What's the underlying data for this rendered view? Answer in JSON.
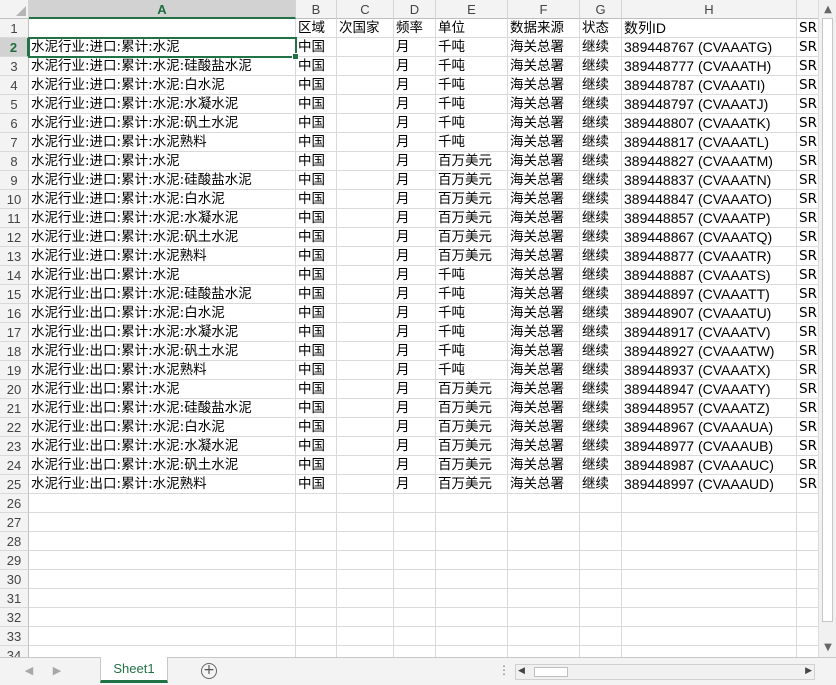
{
  "columns": [
    "A",
    "B",
    "C",
    "D",
    "E",
    "F",
    "G",
    "H",
    ""
  ],
  "selected_column": "A",
  "selected_row": 2,
  "header_row": {
    "row_number": "1",
    "cells": [
      "",
      "区域",
      "次国家",
      "频率",
      "单位",
      "数据来源",
      "状态",
      "数列ID",
      "SR"
    ]
  },
  "data_rows": [
    {
      "row": "2",
      "cells": [
        "水泥行业:进口:累计:水泥",
        "中国",
        "",
        "月",
        "千吨",
        "海关总署",
        "继续",
        "389448767 (CVAAATG)",
        "SR"
      ]
    },
    {
      "row": "3",
      "cells": [
        "水泥行业:进口:累计:水泥:硅酸盐水泥",
        "中国",
        "",
        "月",
        "千吨",
        "海关总署",
        "继续",
        "389448777 (CVAAATH)",
        "SR"
      ]
    },
    {
      "row": "4",
      "cells": [
        "水泥行业:进口:累计:水泥:白水泥",
        "中国",
        "",
        "月",
        "千吨",
        "海关总署",
        "继续",
        "389448787 (CVAAATI)",
        "SR"
      ]
    },
    {
      "row": "5",
      "cells": [
        "水泥行业:进口:累计:水泥:水凝水泥",
        "中国",
        "",
        "月",
        "千吨",
        "海关总署",
        "继续",
        "389448797 (CVAAATJ)",
        "SR"
      ]
    },
    {
      "row": "6",
      "cells": [
        "水泥行业:进口:累计:水泥:矾土水泥",
        "中国",
        "",
        "月",
        "千吨",
        "海关总署",
        "继续",
        "389448807 (CVAAATK)",
        "SR"
      ]
    },
    {
      "row": "7",
      "cells": [
        "水泥行业:进口:累计:水泥熟料",
        "中国",
        "",
        "月",
        "千吨",
        "海关总署",
        "继续",
        "389448817 (CVAAATL)",
        "SR"
      ]
    },
    {
      "row": "8",
      "cells": [
        "水泥行业:进口:累计:水泥",
        "中国",
        "",
        "月",
        "百万美元",
        "海关总署",
        "继续",
        "389448827 (CVAAATM)",
        "SR"
      ]
    },
    {
      "row": "9",
      "cells": [
        "水泥行业:进口:累计:水泥:硅酸盐水泥",
        "中国",
        "",
        "月",
        "百万美元",
        "海关总署",
        "继续",
        "389448837 (CVAAATN)",
        "SR"
      ]
    },
    {
      "row": "10",
      "cells": [
        "水泥行业:进口:累计:水泥:白水泥",
        "中国",
        "",
        "月",
        "百万美元",
        "海关总署",
        "继续",
        "389448847 (CVAAATO)",
        "SR"
      ]
    },
    {
      "row": "11",
      "cells": [
        "水泥行业:进口:累计:水泥:水凝水泥",
        "中国",
        "",
        "月",
        "百万美元",
        "海关总署",
        "继续",
        "389448857 (CVAAATP)",
        "SR"
      ]
    },
    {
      "row": "12",
      "cells": [
        "水泥行业:进口:累计:水泥:矾土水泥",
        "中国",
        "",
        "月",
        "百万美元",
        "海关总署",
        "继续",
        "389448867 (CVAAATQ)",
        "SR"
      ]
    },
    {
      "row": "13",
      "cells": [
        "水泥行业:进口:累计:水泥熟料",
        "中国",
        "",
        "月",
        "百万美元",
        "海关总署",
        "继续",
        "389448877 (CVAAATR)",
        "SR"
      ]
    },
    {
      "row": "14",
      "cells": [
        "水泥行业:出口:累计:水泥",
        "中国",
        "",
        "月",
        "千吨",
        "海关总署",
        "继续",
        "389448887 (CVAAATS)",
        "SR"
      ]
    },
    {
      "row": "15",
      "cells": [
        "水泥行业:出口:累计:水泥:硅酸盐水泥",
        "中国",
        "",
        "月",
        "千吨",
        "海关总署",
        "继续",
        "389448897 (CVAAATT)",
        "SR"
      ]
    },
    {
      "row": "16",
      "cells": [
        "水泥行业:出口:累计:水泥:白水泥",
        "中国",
        "",
        "月",
        "千吨",
        "海关总署",
        "继续",
        "389448907 (CVAAATU)",
        "SR"
      ]
    },
    {
      "row": "17",
      "cells": [
        "水泥行业:出口:累计:水泥:水凝水泥",
        "中国",
        "",
        "月",
        "千吨",
        "海关总署",
        "继续",
        "389448917 (CVAAATV)",
        "SR"
      ]
    },
    {
      "row": "18",
      "cells": [
        "水泥行业:出口:累计:水泥:矾土水泥",
        "中国",
        "",
        "月",
        "千吨",
        "海关总署",
        "继续",
        "389448927 (CVAAATW)",
        "SR"
      ]
    },
    {
      "row": "19",
      "cells": [
        "水泥行业:出口:累计:水泥熟料",
        "中国",
        "",
        "月",
        "千吨",
        "海关总署",
        "继续",
        "389448937 (CVAAATX)",
        "SR"
      ]
    },
    {
      "row": "20",
      "cells": [
        "水泥行业:出口:累计:水泥",
        "中国",
        "",
        "月",
        "百万美元",
        "海关总署",
        "继续",
        "389448947 (CVAAATY)",
        "SR"
      ]
    },
    {
      "row": "21",
      "cells": [
        "水泥行业:出口:累计:水泥:硅酸盐水泥",
        "中国",
        "",
        "月",
        "百万美元",
        "海关总署",
        "继续",
        "389448957 (CVAAATZ)",
        "SR"
      ]
    },
    {
      "row": "22",
      "cells": [
        "水泥行业:出口:累计:水泥:白水泥",
        "中国",
        "",
        "月",
        "百万美元",
        "海关总署",
        "继续",
        "389448967 (CVAAAUA)",
        "SR"
      ]
    },
    {
      "row": "23",
      "cells": [
        "水泥行业:出口:累计:水泥:水凝水泥",
        "中国",
        "",
        "月",
        "百万美元",
        "海关总署",
        "继续",
        "389448977 (CVAAAUB)",
        "SR"
      ]
    },
    {
      "row": "24",
      "cells": [
        "水泥行业:出口:累计:水泥:矾土水泥",
        "中国",
        "",
        "月",
        "百万美元",
        "海关总署",
        "继续",
        "389448987 (CVAAAUC)",
        "SR"
      ]
    },
    {
      "row": "25",
      "cells": [
        "水泥行业:出口:累计:水泥熟料",
        "中国",
        "",
        "月",
        "百万美元",
        "海关总署",
        "继续",
        "389448997 (CVAAAUD)",
        "SR"
      ]
    }
  ],
  "empty_rows": [
    "26",
    "27",
    "28",
    "29",
    "30",
    "31",
    "32",
    "33",
    "34"
  ],
  "sheet_tabs": [
    "Sheet1"
  ],
  "icons": {
    "add_sheet": "plus-circle-icon",
    "nav_prev": "triangle-left-icon",
    "nav_next": "triangle-right-icon"
  },
  "colors": {
    "accent": "#217346",
    "header_bg": "#f3f3f3",
    "gridline": "#dadada"
  }
}
